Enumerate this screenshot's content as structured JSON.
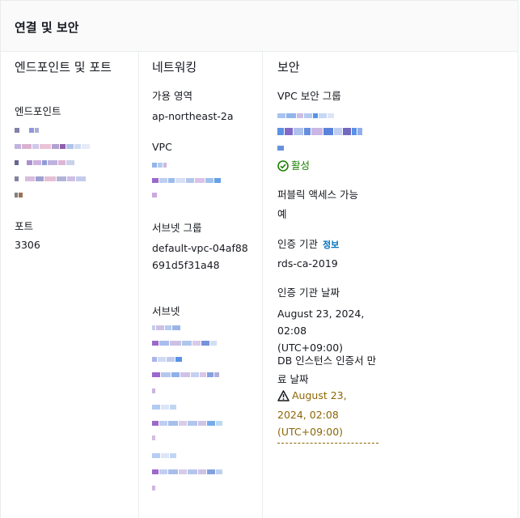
{
  "panel": {
    "title": "연결 및 보안"
  },
  "endpoint_section": {
    "title": "엔드포인트 및 포트",
    "endpoint_label": "엔드포인트",
    "port_label": "포트",
    "port_value": "3306"
  },
  "network_section": {
    "title": "네트워킹",
    "az_label": "가용 영역",
    "az_value": "ap-northeast-2a",
    "vpc_label": "VPC",
    "subnet_group_label": "서브넷 그룹",
    "subnet_group_value": "default-vpc-04af88691d5f31a48",
    "subnet_label": "서브넷"
  },
  "security_section": {
    "title": "보안",
    "sg_label": "VPC 보안 그룹",
    "sg_status": "활성",
    "public_label": "퍼블릭 액세스 가능",
    "public_value": "예",
    "ca_label": "인증 기관",
    "ca_info": "정보",
    "ca_value": "rds-ca-2019",
    "ca_date_label": "인증 기관 날짜",
    "ca_date_value": "August 23, 2024, 02:08 (UTC+09:00)",
    "cert_expiry_label": "DB 인스턴스 인증서 만료 날짜",
    "cert_expiry_value": "August 23, 2024, 02:08 (UTC+09:00)"
  },
  "colors": {
    "link": "#0073bb",
    "success": "#1d8102",
    "warning": "#8d6605",
    "redacted_blue": "#3d7fe0",
    "redacted_purple": "#8a4fc4"
  }
}
